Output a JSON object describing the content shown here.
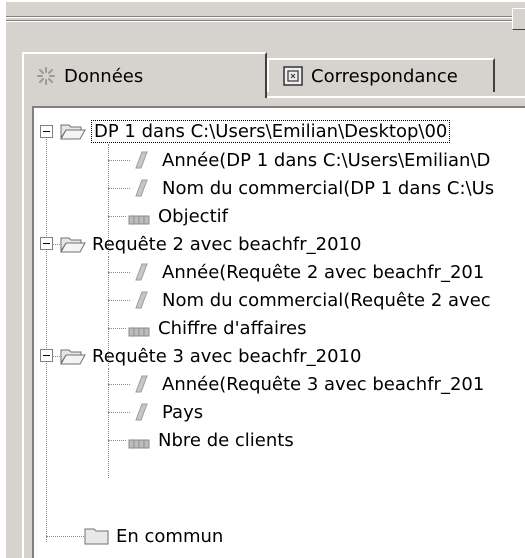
{
  "tabs": [
    {
      "label": "Données",
      "active": true,
      "icon": "data-icon"
    },
    {
      "label": "Correspondance",
      "active": false,
      "icon": "mapping-icon"
    }
  ],
  "tree": {
    "groups": [
      {
        "label": "DP 1 dans C:\\Users\\Emilian\\Desktop\\00",
        "icon": "folder-open-icon",
        "expanded": true,
        "selected": true,
        "items": [
          {
            "label": "Année(DP 1 dans C:\\Users\\Emilian\\D",
            "icon": "dimension-icon"
          },
          {
            "label": "Nom du commercial(DP 1 dans C:\\Us",
            "icon": "dimension-icon"
          },
          {
            "label": "Objectif",
            "icon": "measure-icon"
          }
        ]
      },
      {
        "label": "Requête 2 avec beachfr_2010",
        "icon": "folder-open-icon",
        "expanded": true,
        "items": [
          {
            "label": "Année(Requête 2 avec beachfr_201",
            "icon": "dimension-icon"
          },
          {
            "label": "Nom du commercial(Requête 2 avec",
            "icon": "dimension-icon"
          },
          {
            "label": "Chiffre d'affaires",
            "icon": "measure-icon"
          }
        ]
      },
      {
        "label": "Requête 3 avec beachfr_2010",
        "icon": "folder-open-icon",
        "expanded": true,
        "items": [
          {
            "label": "Année(Requête 3 avec beachfr_201",
            "icon": "dimension-icon"
          },
          {
            "label": "Pays",
            "icon": "dimension-icon"
          },
          {
            "label": "Nbre de clients",
            "icon": "measure-icon"
          }
        ]
      }
    ],
    "common": {
      "label": "En commun",
      "icon": "folder-closed-icon"
    }
  },
  "colors": {
    "panel": "#d6d3ce",
    "dimension_icon": "#c8c8c8",
    "folder": "#e8e8e8"
  }
}
